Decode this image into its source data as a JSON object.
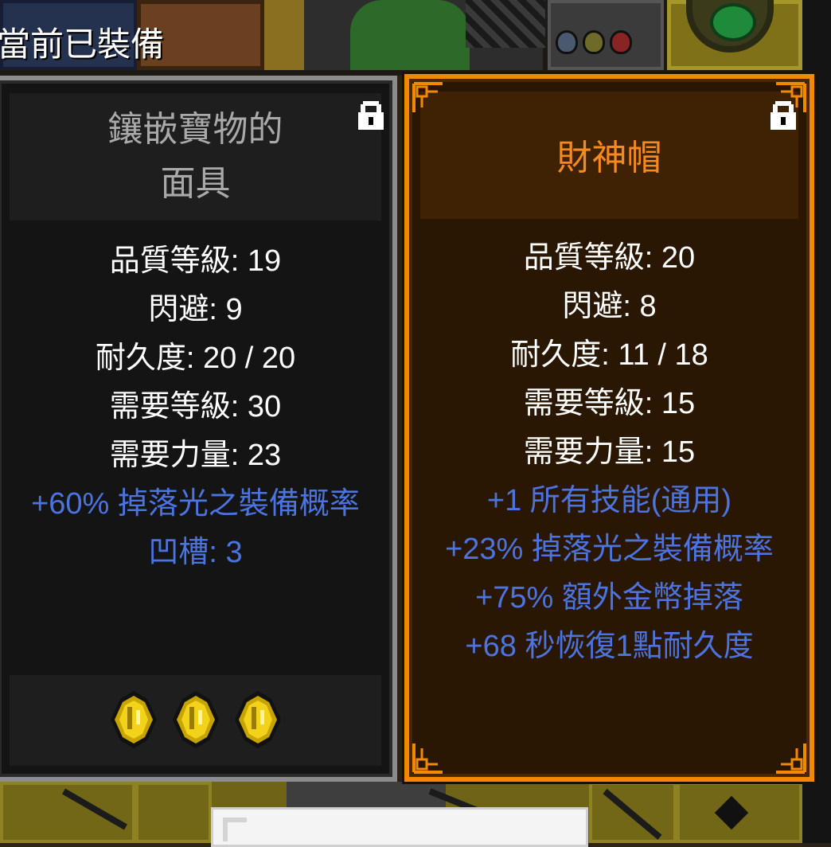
{
  "header": {
    "equipped_label": "當前已裝備"
  },
  "equipped_item": {
    "title_line1": "鑲嵌寶物的",
    "title_line2": "面具",
    "locked": true,
    "stats_white": [
      "品質等級: 19",
      "閃避: 9",
      "耐久度: 20 / 20",
      "需要等級: 30",
      "需要力量: 23"
    ],
    "stats_blue": [
      "+60% 掉落光之裝備概率",
      "凹槽: 3"
    ],
    "socket_gems": [
      "gold-gem",
      "gold-gem",
      "gold-gem"
    ]
  },
  "compared_item": {
    "title": "財神帽",
    "locked": true,
    "stats_white": [
      "品質等級: 20",
      "閃避: 8",
      "耐久度: 11 / 18",
      "需要等級: 15",
      "需要力量: 15"
    ],
    "stats_blue": [
      "+1 所有技能(通用)",
      "+23% 掉落光之裝備概率",
      "+75% 額外金幣掉落",
      "+68 秒恢復1點耐久度"
    ]
  },
  "colors": {
    "legendary_orange": "#f58a1e",
    "magic_blue": "#4c74e0",
    "normal_gray": "#a9a9a9"
  }
}
